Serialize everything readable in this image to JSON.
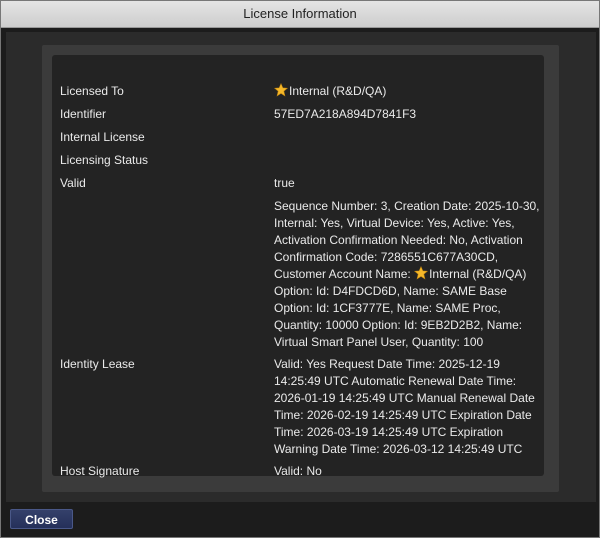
{
  "window": {
    "title": "License Information"
  },
  "fields": {
    "licensed_to": {
      "label": "Licensed To",
      "value": "Internal (R&D/QA)",
      "icon": "star-icon"
    },
    "identifier": {
      "label": "Identifier",
      "value": "57ED7A218A894D7841F3"
    },
    "internal_license": {
      "label": "Internal License"
    },
    "licensing_status": {
      "label": "Licensing Status"
    },
    "valid": {
      "label": "Valid",
      "value": "true"
    },
    "details": {
      "value_before_star": "Sequence Number: 3, Creation Date: 2025-10-30, Internal: Yes, Virtual Device: Yes, Active: Yes, Activation Confirmation Needed: No, Activation Confirmation Code: 7286551C677A30CD, Customer Account Name: ",
      "value_after_star": "Internal (R&D/QA) Option: Id: D4FDCD6D, Name: SAME Base Option: Id: 1CF3777E, Name: SAME Proc, Quantity: 10000 Option: Id: 9EB2D2B2, Name: Virtual Smart Panel User, Quantity: 100",
      "icon": "star-icon"
    },
    "identity_lease": {
      "label": "Identity Lease",
      "value": "Valid: Yes Request Date Time: 2025-12-19 14:25:49 UTC Automatic Renewal Date Time: 2026-01-19 14:25:49 UTC Manual Renewal Date Time: 2026-02-19 14:25:49 UTC Expiration Date Time: 2026-03-19 14:25:49 UTC Expiration Warning Date Time: 2026-03-12 14:25:49 UTC"
    },
    "host_signature": {
      "label": "Host Signature",
      "value": "Valid: No"
    }
  },
  "buttons": {
    "close_label": "Close"
  },
  "colors": {
    "star": "#f5b82a",
    "button": "#2b3662"
  }
}
